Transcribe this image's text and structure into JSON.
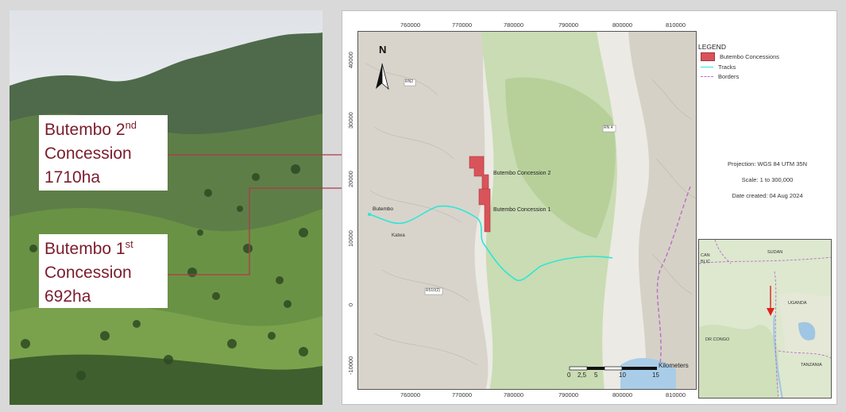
{
  "photo": {
    "callout_2": {
      "name": "Butembo 2",
      "sup": "nd",
      "line2": "Concession",
      "area": "1710ha"
    },
    "callout_1": {
      "name": "Butembo 1",
      "sup": "st",
      "line2": "Concession",
      "area": "692ha"
    }
  },
  "map": {
    "x_ticks": [
      "760000",
      "770000",
      "780000",
      "790000",
      "800000",
      "810000"
    ],
    "y_ticks": [
      "40000",
      "30000",
      "20000",
      "10000",
      "0",
      "-10000"
    ],
    "north_label": "N",
    "places": {
      "butembo": "Butembo",
      "katwa": "Katwa",
      "concession_2": "Butembo Concession 2",
      "concession_1": "Butembo Concession 1",
      "road_rn2": "RN2",
      "road_rn4": "RN 4",
      "road_r510": "R510(2)"
    },
    "scale_bar": {
      "ticks": [
        "0",
        "2,5",
        "5",
        "10",
        "15"
      ],
      "unit": "Kilometers"
    },
    "colors": {
      "concession": "#d9545a",
      "tracks": "#2ee6d4",
      "borders": "#b86fc7",
      "callout_text": "#7b1c2c",
      "leader_line": "#b03a48"
    }
  },
  "legend": {
    "title": "LEGEND",
    "items": [
      {
        "label": "Butembo Concessions",
        "symbol": "red-box-icon"
      },
      {
        "label": "Tracks",
        "symbol": "cyan-line-icon"
      },
      {
        "label": "Borders",
        "symbol": "purple-dashed-line-icon"
      }
    ]
  },
  "meta": {
    "projection": "Projection: WGS 84 UTM 35N",
    "scale": "Scale: 1 to 300,000",
    "date": "Date created: 04 Aug 2024"
  },
  "inset": {
    "sudan": "SUDAN",
    "car": [
      "CAN",
      "BLIC"
    ],
    "uganda": "UGANDA",
    "drc": "DR CONGO",
    "tanzania": "TANZANIA"
  }
}
